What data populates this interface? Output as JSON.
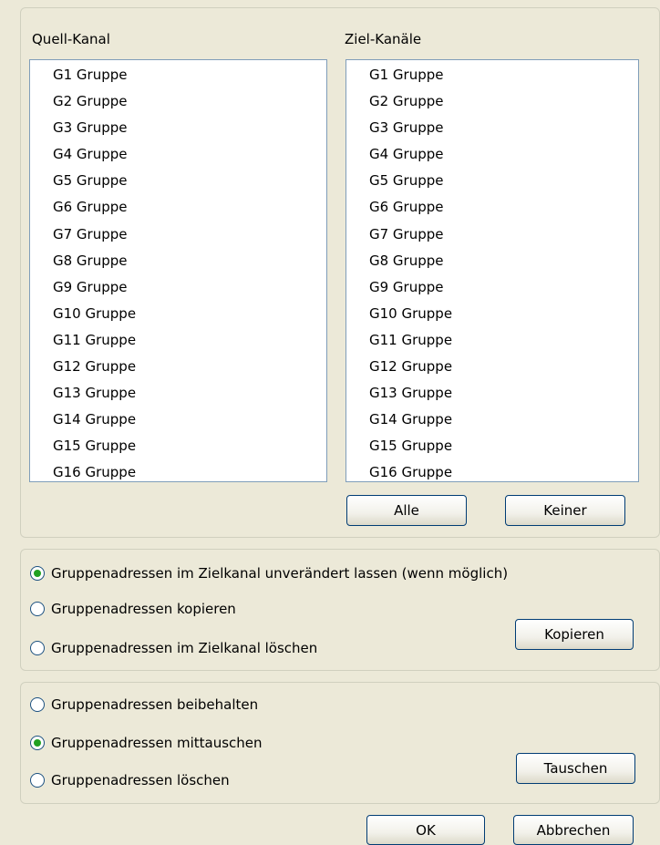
{
  "source": {
    "label": "Quell-Kanal",
    "items": [
      "G1 Gruppe",
      "G2 Gruppe",
      "G3 Gruppe",
      "G4 Gruppe",
      "G5 Gruppe",
      "G6 Gruppe",
      "G7 Gruppe",
      "G8 Gruppe",
      "G9 Gruppe",
      "G10 Gruppe",
      "G11 Gruppe",
      "G12 Gruppe",
      "G13 Gruppe",
      "G14 Gruppe",
      "G15 Gruppe",
      "G16 Gruppe"
    ]
  },
  "target": {
    "label": "Ziel-Kanäle",
    "items": [
      "G1 Gruppe",
      "G2 Gruppe",
      "G3 Gruppe",
      "G4 Gruppe",
      "G5 Gruppe",
      "G6 Gruppe",
      "G7 Gruppe",
      "G8 Gruppe",
      "G9 Gruppe",
      "G10 Gruppe",
      "G11 Gruppe",
      "G12 Gruppe",
      "G13 Gruppe",
      "G14 Gruppe",
      "G15 Gruppe",
      "G16 Gruppe"
    ],
    "all_button": "Alle",
    "none_button": "Keiner"
  },
  "copy_options": {
    "items": [
      {
        "label": "Gruppenadressen im Zielkanal unverändert lassen (wenn möglich)",
        "checked": true
      },
      {
        "label": "Gruppenadressen kopieren",
        "checked": false
      },
      {
        "label": "Gruppenadressen im Zielkanal löschen",
        "checked": false
      }
    ],
    "button": "Kopieren"
  },
  "swap_options": {
    "items": [
      {
        "label": "Gruppenadressen beibehalten",
        "checked": false
      },
      {
        "label": "Gruppenadressen mittauschen",
        "checked": true
      },
      {
        "label": "Gruppenadressen löschen",
        "checked": false
      }
    ],
    "button": "Tauschen"
  },
  "footer": {
    "ok": "OK",
    "cancel": "Abbrechen"
  }
}
